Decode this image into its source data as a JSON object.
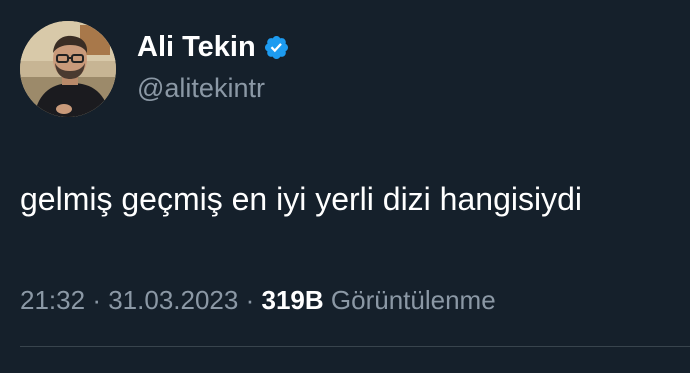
{
  "author": {
    "display_name": "Ali Tekin",
    "handle": "@alitekintr",
    "verified": true,
    "avatar_icon": "profile-photo"
  },
  "tweet": {
    "text": "gelmiş geçmiş en iyi yerli dizi hangisiydi",
    "time": "21:32",
    "separator": "·",
    "date": "31.03.2023",
    "views_count": "319B",
    "views_label": "Görüntülenme"
  },
  "colors": {
    "background": "#15202b",
    "primary_text": "#ffffff",
    "secondary_text": "#8b98a5",
    "verified_badge": "#1d9bf0",
    "divider": "#38444d"
  }
}
